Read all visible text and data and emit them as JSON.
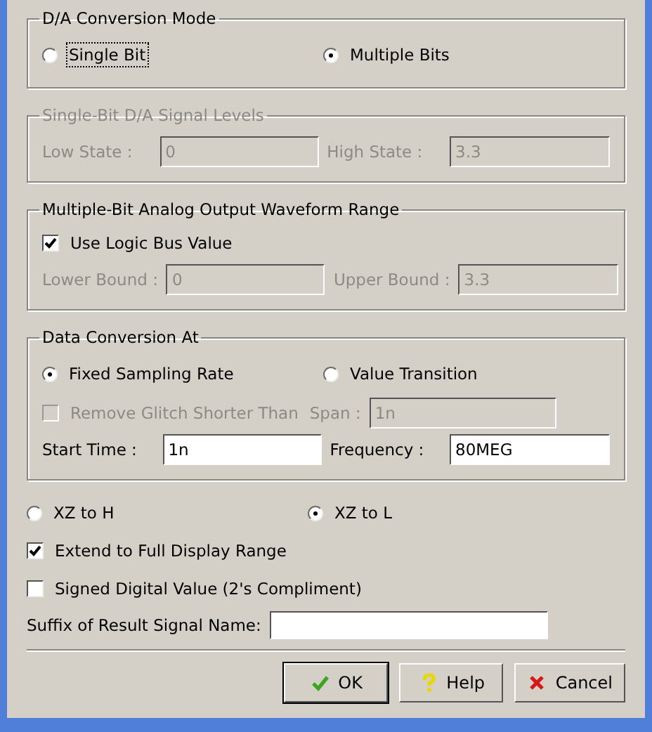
{
  "mode": {
    "title": "D/A Conversion Mode",
    "options": [
      {
        "label": "Single Bit",
        "selected": false,
        "focused": true
      },
      {
        "label": "Multiple Bits",
        "selected": true,
        "focused": false
      }
    ]
  },
  "single_bit_levels": {
    "title": "Single-Bit D/A Signal Levels",
    "disabled": true,
    "fields": [
      {
        "label": "Low State :",
        "value": "0"
      },
      {
        "label": "High State :",
        "value": "3.3"
      }
    ]
  },
  "multi_bit_range": {
    "title": "Multiple-Bit Analog Output Waveform Range",
    "use_logic_bus": {
      "label": "Use Logic Bus Value",
      "checked": true
    },
    "disabled": true,
    "fields": [
      {
        "label": "Lower Bound :",
        "value": "0"
      },
      {
        "label": "Upper Bound :",
        "value": "3.3"
      }
    ]
  },
  "conversion": {
    "title": "Data Conversion At",
    "options": [
      {
        "label": "Fixed Sampling Rate",
        "selected": true
      },
      {
        "label": "Value Transition",
        "selected": false
      }
    ],
    "remove_glitch": {
      "label": "Remove Glitch Shorter Than",
      "checked": false,
      "disabled": true
    },
    "span": {
      "label": "Span :",
      "value": "1n",
      "disabled": true
    },
    "fields": [
      {
        "label": "Start Time :",
        "value": "1n"
      },
      {
        "label": "Frequency :",
        "value": "80MEG"
      }
    ]
  },
  "xz_options": [
    {
      "label": "XZ to H",
      "selected": false
    },
    {
      "label": "XZ to L",
      "selected": true
    }
  ],
  "extend": {
    "label": "Extend to Full Display Range",
    "checked": true
  },
  "signed": {
    "label": "Signed Digital Value (2's Compliment)",
    "checked": false
  },
  "suffix": {
    "label": "Suffix of Result Signal Name:"
  },
  "buttons": [
    {
      "label": "OK",
      "kind": "ok",
      "default": true
    },
    {
      "label": "Help",
      "kind": "help",
      "default": false
    },
    {
      "label": "Cancel",
      "kind": "cancel",
      "default": false
    }
  ]
}
